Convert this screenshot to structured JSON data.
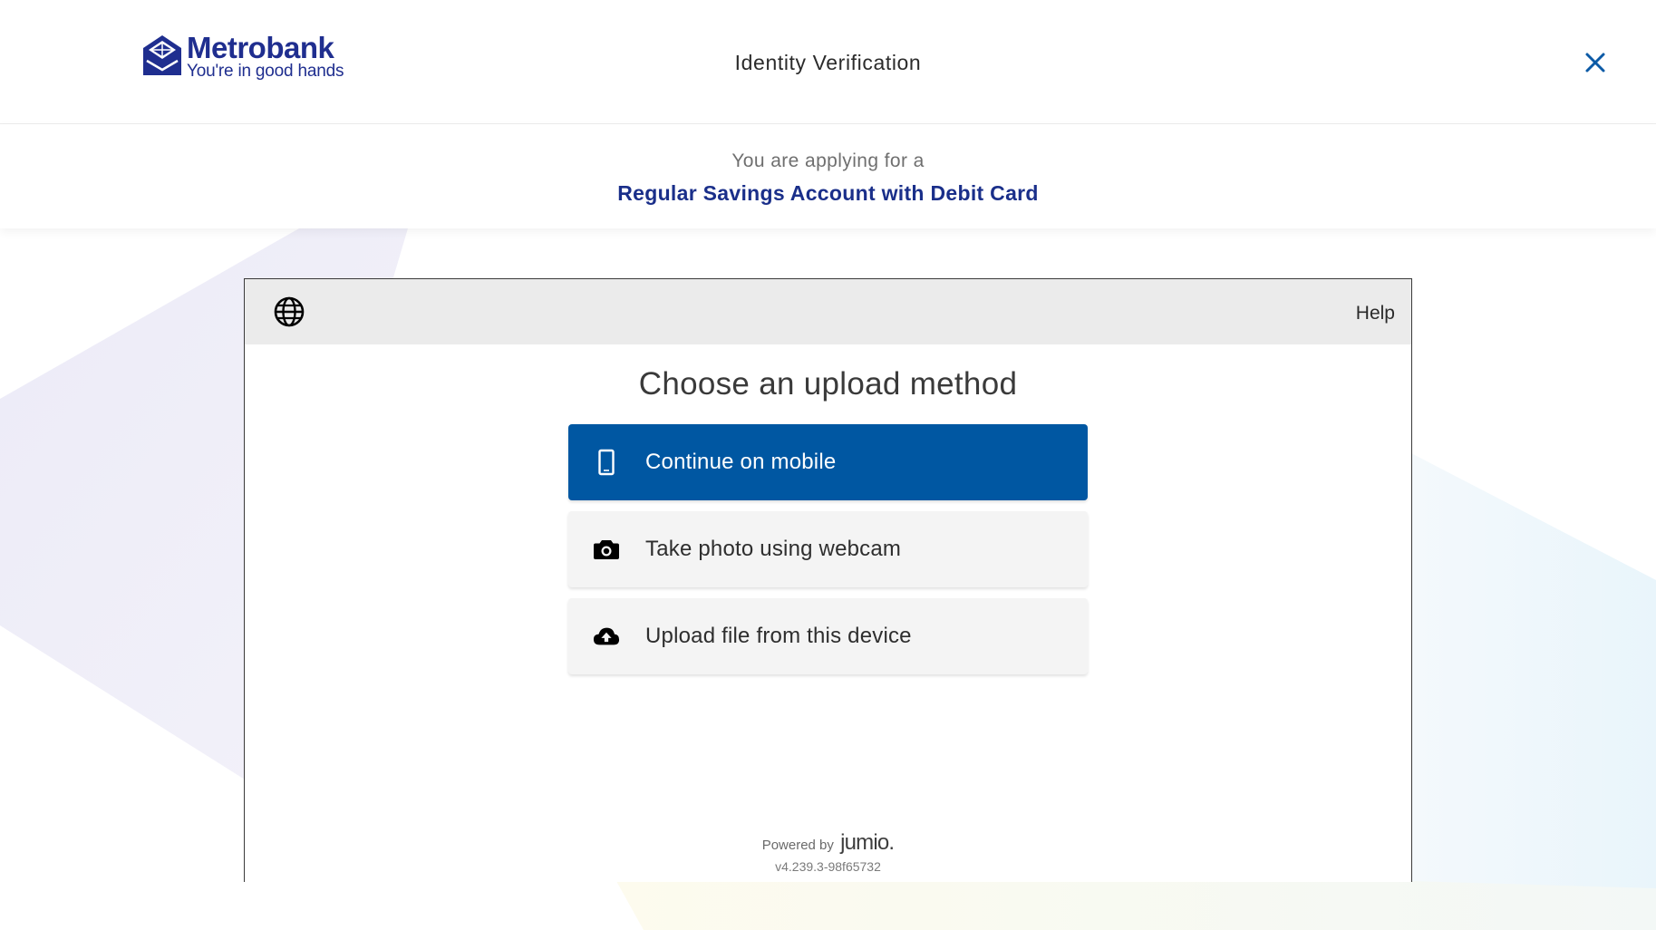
{
  "header": {
    "logo_name": "Metrobank",
    "logo_tagline": "You're in good hands",
    "title": "Identity Verification",
    "close_icon": "close-icon"
  },
  "applying": {
    "label": "You are applying for a",
    "product": "Regular Savings Account with Debit Card"
  },
  "widget": {
    "language_icon": "globe-icon",
    "help_label": "Help",
    "heading": "Choose an upload method",
    "options": [
      {
        "label": "Continue on mobile",
        "icon": "mobile-phone-icon",
        "style": "primary"
      },
      {
        "label": "Take photo using webcam",
        "icon": "camera-icon",
        "style": "secondary"
      },
      {
        "label": "Upload file from this device",
        "icon": "cloud-upload-icon",
        "style": "secondary"
      }
    ],
    "powered_by": "Powered by",
    "powered_brand": "jumio.",
    "version": "v4.239.3-98f65732"
  },
  "colors": {
    "brand_navy": "#1a2f8a",
    "primary_button": "#0057a2",
    "secondary_button": "#f4f4f4",
    "close_icon": "#0b5aa6"
  }
}
